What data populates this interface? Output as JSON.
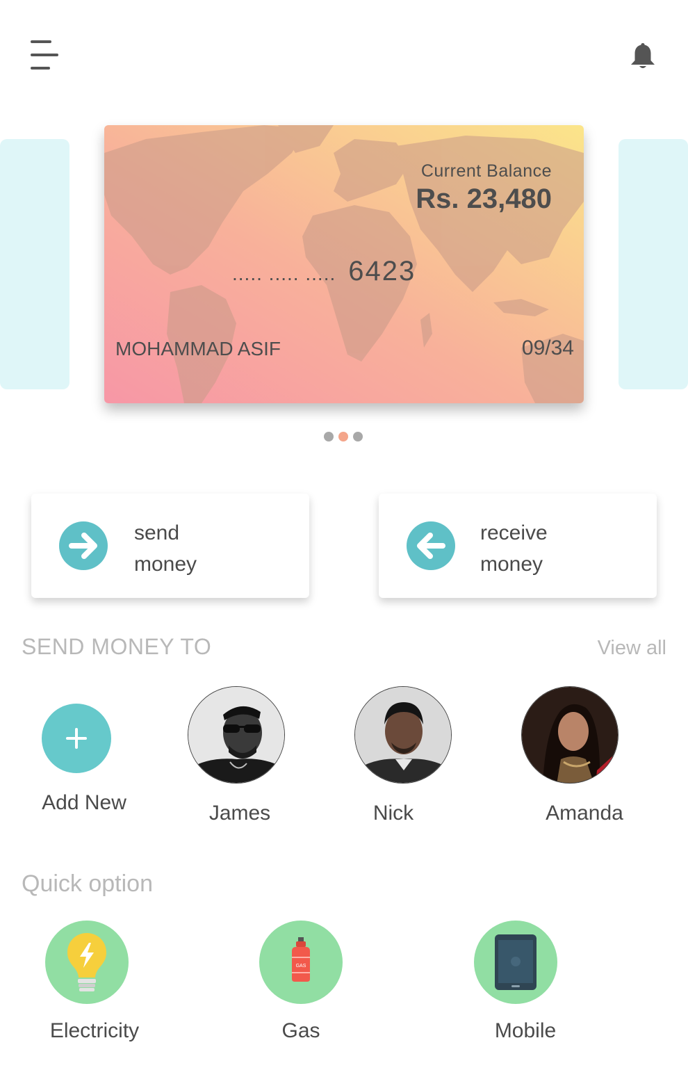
{
  "header": {
    "menu_icon": "hamburger-menu-icon",
    "notification_icon": "bell-icon"
  },
  "card": {
    "balance_label": "Current Balance",
    "balance_value": "Rs. 23,480",
    "masked_groups": [
      "……",
      "……",
      "……"
    ],
    "masked_text": "..... ..... .....",
    "last_digits": "6423",
    "holder_name": "MOHAMMAD ASIF",
    "expiry": "09/34",
    "gradient_colors": [
      "#f797a6",
      "#f8b19a",
      "#fbe58a"
    ]
  },
  "carousel": {
    "page_count": 3,
    "active_page": 2,
    "dot_color": "#a8a8a8",
    "active_dot_color": "#f4a58a"
  },
  "actions": {
    "send": {
      "line1": "send",
      "line2": "money",
      "icon": "arrow-right-icon"
    },
    "receive": {
      "line1": "receive",
      "line2": "money",
      "icon": "arrow-left-icon"
    },
    "accent_color": "#5fc0c7"
  },
  "send_money_to": {
    "title": "SEND MONEY TO",
    "view_all": "View all",
    "add_new_label": "Add New",
    "contacts": [
      {
        "name": "James"
      },
      {
        "name": "Nick"
      },
      {
        "name": "Amanda"
      }
    ]
  },
  "quick_option": {
    "title": "Quick option",
    "items": [
      {
        "label": "Electricity",
        "icon": "light-bulb-icon"
      },
      {
        "label": "Gas",
        "icon": "gas-cylinder-icon"
      },
      {
        "label": "Mobile",
        "icon": "mobile-phone-icon"
      }
    ],
    "circle_color": "#91dea3"
  }
}
